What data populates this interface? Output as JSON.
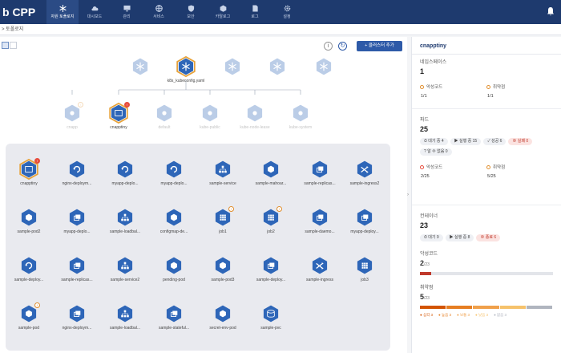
{
  "app": {
    "brand": "b CPP"
  },
  "nav": [
    {
      "label": "자원 토폴로지",
      "icon": "snowflake-icon",
      "active": true
    },
    {
      "label": "대시보드",
      "icon": "cloud-icon"
    },
    {
      "label": "관리",
      "icon": "monitor-icon"
    },
    {
      "label": "서비스",
      "icon": "globe-icon"
    },
    {
      "label": "보안",
      "icon": "shield-icon"
    },
    {
      "label": "카탈로그",
      "icon": "cube-icon"
    },
    {
      "label": "로그",
      "icon": "document-icon"
    },
    {
      "label": "설정",
      "icon": "gear-icon"
    }
  ],
  "breadcrumb": "> 토폴로지",
  "toolbar": {
    "add_cluster": "+ 클러스터 추가",
    "info": "i",
    "refresh": "↻"
  },
  "top_nodes": [
    {
      "label": ""
    },
    {
      "label": "k8s_kubeconfig.yaml",
      "selected": true
    },
    {
      "label": ""
    },
    {
      "label": ""
    },
    {
      "label": ""
    }
  ],
  "ns_nodes": [
    {
      "label": "cnapp",
      "badge": "w"
    },
    {
      "label": "cnapptiny",
      "badge": "r"
    },
    {
      "label": "default"
    },
    {
      "label": "kube-public"
    },
    {
      "label": "kube-node-lease"
    },
    {
      "label": "kube-system"
    }
  ],
  "grid_nodes": [
    {
      "label": "cnapptiny",
      "icon": "namespace",
      "badge": "r"
    },
    {
      "label": "nginx-deploym...",
      "icon": "refresh"
    },
    {
      "label": "myapp-deplo...",
      "icon": "refresh"
    },
    {
      "label": "myapp-deplo...",
      "icon": "refresh"
    },
    {
      "label": "sample-service",
      "icon": "tree"
    },
    {
      "label": "sample-mahoar...",
      "icon": "cube"
    },
    {
      "label": "sample-replicas...",
      "icon": "stack"
    },
    {
      "label": "sample-ingress2",
      "icon": "shuffle"
    },
    {
      "label": "sample-pod2",
      "icon": "cube"
    },
    {
      "label": "myapp-deplo...",
      "icon": "stack"
    },
    {
      "label": "sample-loadbal...",
      "icon": "tree"
    },
    {
      "label": "configmap-de...",
      "icon": "cube"
    },
    {
      "label": "job1",
      "icon": "grid",
      "badge": "w"
    },
    {
      "label": "job2",
      "icon": "grid",
      "badge": "w"
    },
    {
      "label": "sample-daemo...",
      "icon": "stack"
    },
    {
      "label": "myapp-deploy...",
      "icon": "stack"
    },
    {
      "label": "sample-deploy...",
      "icon": "refresh"
    },
    {
      "label": "sample-replicas...",
      "icon": "stack"
    },
    {
      "label": "sample-service2",
      "icon": "tree"
    },
    {
      "label": "pending-pod",
      "icon": "cube"
    },
    {
      "label": "sample-pod3",
      "icon": "cube"
    },
    {
      "label": "sample-deploy...",
      "icon": "stack"
    },
    {
      "label": "sample-ingress",
      "icon": "shuffle"
    },
    {
      "label": "job3",
      "icon": "grid"
    },
    {
      "label": "sample-pod",
      "icon": "cube",
      "badge": "w"
    },
    {
      "label": "nginx-deploym...",
      "icon": "stack"
    },
    {
      "label": "sample-loadbal...",
      "icon": "tree"
    },
    {
      "label": "sample-stateful...",
      "icon": "stack"
    },
    {
      "label": "secret-env-pod",
      "icon": "cube"
    },
    {
      "label": "sample-pvc",
      "icon": "disk"
    }
  ],
  "panel": {
    "title": "cnapptiny",
    "namespace": {
      "title": "네임스페이스",
      "count": "1",
      "bad_code_label": "악성코드",
      "bad_code_value": "1/1",
      "vuln_label": "취약점",
      "vuln_value": "1/1"
    },
    "pod": {
      "title": "파드",
      "count": "25",
      "chips": [
        {
          "text": "⏱ 대기 중 4",
          "red": false
        },
        {
          "text": "▶ 실행 중 15",
          "red": false
        },
        {
          "text": "✓ 성공 6",
          "red": false
        },
        {
          "text": "⊗ 실패 0",
          "red": true
        },
        {
          "text": "? 알 수 없음 0",
          "red": false
        }
      ],
      "bad_code_label": "악성코드",
      "bad_code_value": "2/25",
      "vuln_label": "취약점",
      "vuln_value": "5/25"
    },
    "container": {
      "title": "컨테이너",
      "count": "23",
      "chips": [
        {
          "text": "⏱ 대기 9",
          "red": false
        },
        {
          "text": "▶ 실행 중 8",
          "red": false
        },
        {
          "text": "⊗ 종료 6",
          "red": true
        }
      ],
      "bad_code_title": "악성코드",
      "bad_code_num": "2",
      "bad_code_den": "/23",
      "bad_code_fraction": 0.087,
      "vuln_title": "취약점",
      "vuln_num": "5",
      "vuln_den": "/23",
      "legend": [
        "● 심각 3",
        "● 높음 3",
        "● 보통 3",
        "● 낮음 3",
        "● 없음 3"
      ],
      "colors": [
        "#d35400",
        "#e67e22",
        "#f0a04b",
        "#f6c26b",
        "#b0b5bf"
      ]
    }
  }
}
